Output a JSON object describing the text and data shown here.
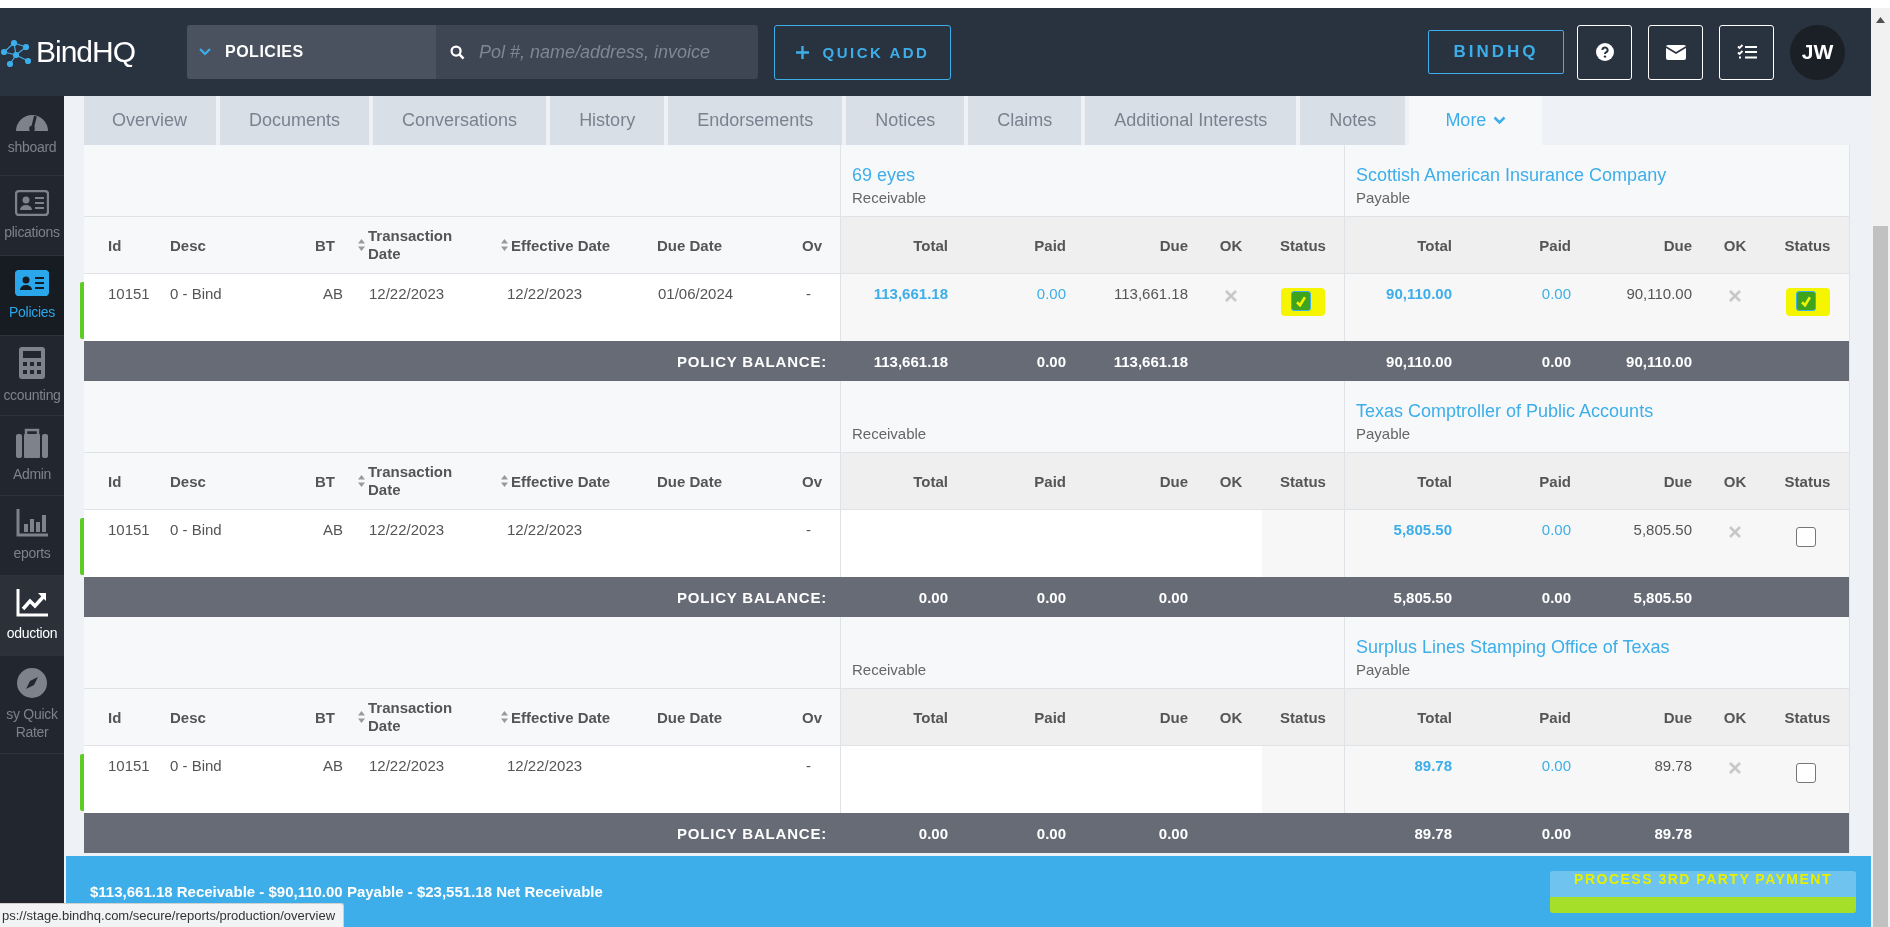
{
  "header": {
    "logo": "BindHQ",
    "scope": "POLICIES",
    "search_placeholder": "Pol #, name/address, invoice",
    "quick_add": "QUICK ADD",
    "bindhq_button": "BINDHQ",
    "avatar": "JW"
  },
  "sidebar": [
    {
      "label": "shboard",
      "selected": false,
      "hovered": false
    },
    {
      "label": "plications",
      "selected": false,
      "hovered": false
    },
    {
      "label": "Policies",
      "selected": true,
      "hovered": false
    },
    {
      "label": "ccounting",
      "selected": false,
      "hovered": false
    },
    {
      "label": "Admin",
      "selected": false,
      "hovered": false
    },
    {
      "label": "eports",
      "selected": false,
      "hovered": false
    },
    {
      "label": "oduction",
      "selected": false,
      "hovered": true
    },
    {
      "label": "sy Quick Rater",
      "selected": false,
      "hovered": false
    }
  ],
  "tabs": [
    {
      "label": "Overview",
      "selected": false,
      "menu": false
    },
    {
      "label": "Documents",
      "selected": false,
      "menu": false
    },
    {
      "label": "Conversations",
      "selected": false,
      "menu": false
    },
    {
      "label": "History",
      "selected": false,
      "menu": false
    },
    {
      "label": "Endorsements",
      "selected": false,
      "menu": false
    },
    {
      "label": "Notices",
      "selected": false,
      "menu": false
    },
    {
      "label": "Claims",
      "selected": false,
      "menu": false
    },
    {
      "label": "Additional Interests",
      "selected": false,
      "menu": false
    },
    {
      "label": "Notes",
      "selected": false,
      "menu": false
    },
    {
      "label": "More",
      "selected": true,
      "menu": true
    }
  ],
  "sections": [
    {
      "receivable": {
        "party": "69 eyes",
        "label": "Receivable",
        "columns": [
          "Total",
          "Paid",
          "Due",
          "OK",
          "Status"
        ]
      },
      "payable": {
        "party": "Scottish American Insurance Company",
        "label": "Payable",
        "columns": [
          "Total",
          "Paid",
          "Due",
          "OK",
          "Status"
        ]
      },
      "columns": [
        {
          "label": "Id",
          "sortable": false
        },
        {
          "label": "Desc",
          "sortable": false
        },
        {
          "label": "BT",
          "sortable": false
        },
        {
          "label": "Transaction Date",
          "sortable": true
        },
        {
          "label": "Effective Date",
          "sortable": true
        },
        {
          "label": "Due Date",
          "sortable": false
        },
        {
          "label": "Ov",
          "sortable": false
        }
      ],
      "row": {
        "id": "10151",
        "desc": "0 - Bind",
        "bt": "AB",
        "transaction_date": "12/22/2023",
        "effective_date": "12/22/2023",
        "due_date": "01/06/2024",
        "ov": "-",
        "receivable": {
          "total": "113,661.18",
          "paid": "0.00",
          "due": "113,661.18",
          "ok": false,
          "checked": true,
          "highlighted": true
        },
        "payable": {
          "total": "90,110.00",
          "paid": "0.00",
          "due": "90,110.00",
          "ok": false,
          "checked": true,
          "highlighted": true
        }
      },
      "balance": {
        "label": "POLICY BALANCE:",
        "receivable": [
          "113,661.18",
          "0.00",
          "113,661.18"
        ],
        "payable": [
          "90,110.00",
          "0.00",
          "90,110.00"
        ]
      }
    },
    {
      "receivable": {
        "label": "Receivable",
        "columns": [
          "Total",
          "Paid",
          "Due",
          "OK",
          "Status"
        ]
      },
      "payable": {
        "party": "Texas Comptroller of Public Accounts",
        "label": "Payable",
        "columns": [
          "Total",
          "Paid",
          "Due",
          "OK",
          "Status"
        ]
      },
      "columns": [
        {
          "label": "Id",
          "sortable": false
        },
        {
          "label": "Desc",
          "sortable": false
        },
        {
          "label": "BT",
          "sortable": false
        },
        {
          "label": "Transaction Date",
          "sortable": true
        },
        {
          "label": "Effective Date",
          "sortable": true
        },
        {
          "label": "Due Date",
          "sortable": false
        },
        {
          "label": "Ov",
          "sortable": false
        }
      ],
      "row": {
        "id": "10151",
        "desc": "0 - Bind",
        "bt": "AB",
        "transaction_date": "12/22/2023",
        "effective_date": "12/22/2023",
        "ov": "-",
        "payable": {
          "total": "5,805.50",
          "paid": "0.00",
          "due": "5,805.50",
          "ok": false,
          "checked": false,
          "highlighted": false
        }
      },
      "balance": {
        "label": "POLICY BALANCE:",
        "receivable": [
          "0.00",
          "0.00",
          "0.00"
        ],
        "payable": [
          "5,805.50",
          "0.00",
          "5,805.50"
        ]
      }
    },
    {
      "receivable": {
        "label": "Receivable",
        "columns": [
          "Total",
          "Paid",
          "Due",
          "OK",
          "Status"
        ]
      },
      "payable": {
        "party": "Surplus Lines Stamping Office of Texas",
        "label": "Payable",
        "columns": [
          "Total",
          "Paid",
          "Due",
          "OK",
          "Status"
        ]
      },
      "columns": [
        {
          "label": "Id",
          "sortable": false
        },
        {
          "label": "Desc",
          "sortable": false
        },
        {
          "label": "BT",
          "sortable": false
        },
        {
          "label": "Transaction Date",
          "sortable": true
        },
        {
          "label": "Effective Date",
          "sortable": true
        },
        {
          "label": "Due Date",
          "sortable": false
        },
        {
          "label": "Ov",
          "sortable": false
        }
      ],
      "row": {
        "id": "10151",
        "desc": "0 - Bind",
        "bt": "AB",
        "transaction_date": "12/22/2023",
        "effective_date": "12/22/2023",
        "ov": "-",
        "payable": {
          "total": "89.78",
          "paid": "0.00",
          "due": "89.78",
          "ok": false,
          "checked": false,
          "highlighted": false
        }
      },
      "balance": {
        "label": "POLICY BALANCE:",
        "receivable": [
          "0.00",
          "0.00",
          "0.00"
        ],
        "payable": [
          "89.78",
          "0.00",
          "89.78"
        ]
      }
    }
  ],
  "footer": {
    "summary": "$113,661.18 Receivable - $90,110.00 Payable - $23,551.18 Net Receivable",
    "button": {
      "label": "PROCESS 3RD PARTY PAYMENT",
      "highlighted": true
    }
  },
  "status_url": "ps://stage.bindhq.com/secure/reports/production/overview"
}
